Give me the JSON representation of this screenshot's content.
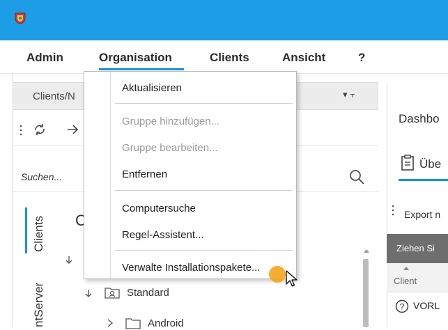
{
  "menubar": {
    "items": [
      "Admin",
      "Organisation",
      "Clients",
      "Ansicht",
      "?"
    ]
  },
  "left_panel": {
    "header_title": "Clients/N",
    "pin_label": "▾ ⫟",
    "search_placeholder": "Suchen...",
    "vertical_tabs": [
      "Clients",
      "ntServer"
    ],
    "tree": [
      {
        "label": "C"
      },
      {
        "label": "Standard"
      },
      {
        "label": "Android"
      }
    ]
  },
  "right_panel": {
    "title": "Dashbo",
    "tab_label": "Übe",
    "export_label": "Export n",
    "grid_header": "Ziehen Si",
    "column_label": "Client",
    "row_text": "VORL"
  },
  "dropdown": {
    "items": [
      {
        "label": "Aktualisieren",
        "enabled": true
      },
      {
        "label": "Gruppe hinzufügen...",
        "enabled": false
      },
      {
        "label": "Gruppe bearbeiten...",
        "enabled": false
      },
      {
        "label": "Entfernen",
        "enabled": true
      },
      {
        "label": "Computersuche",
        "enabled": true
      },
      {
        "label": "Regel-Assistent...",
        "enabled": true
      },
      {
        "label": "Verwalte Installationspakete...",
        "enabled": true
      }
    ]
  },
  "colors": {
    "titlebar": "#1c9de6",
    "accent": "#1a8fe0",
    "cursor_highlight": "#f5a51a"
  }
}
